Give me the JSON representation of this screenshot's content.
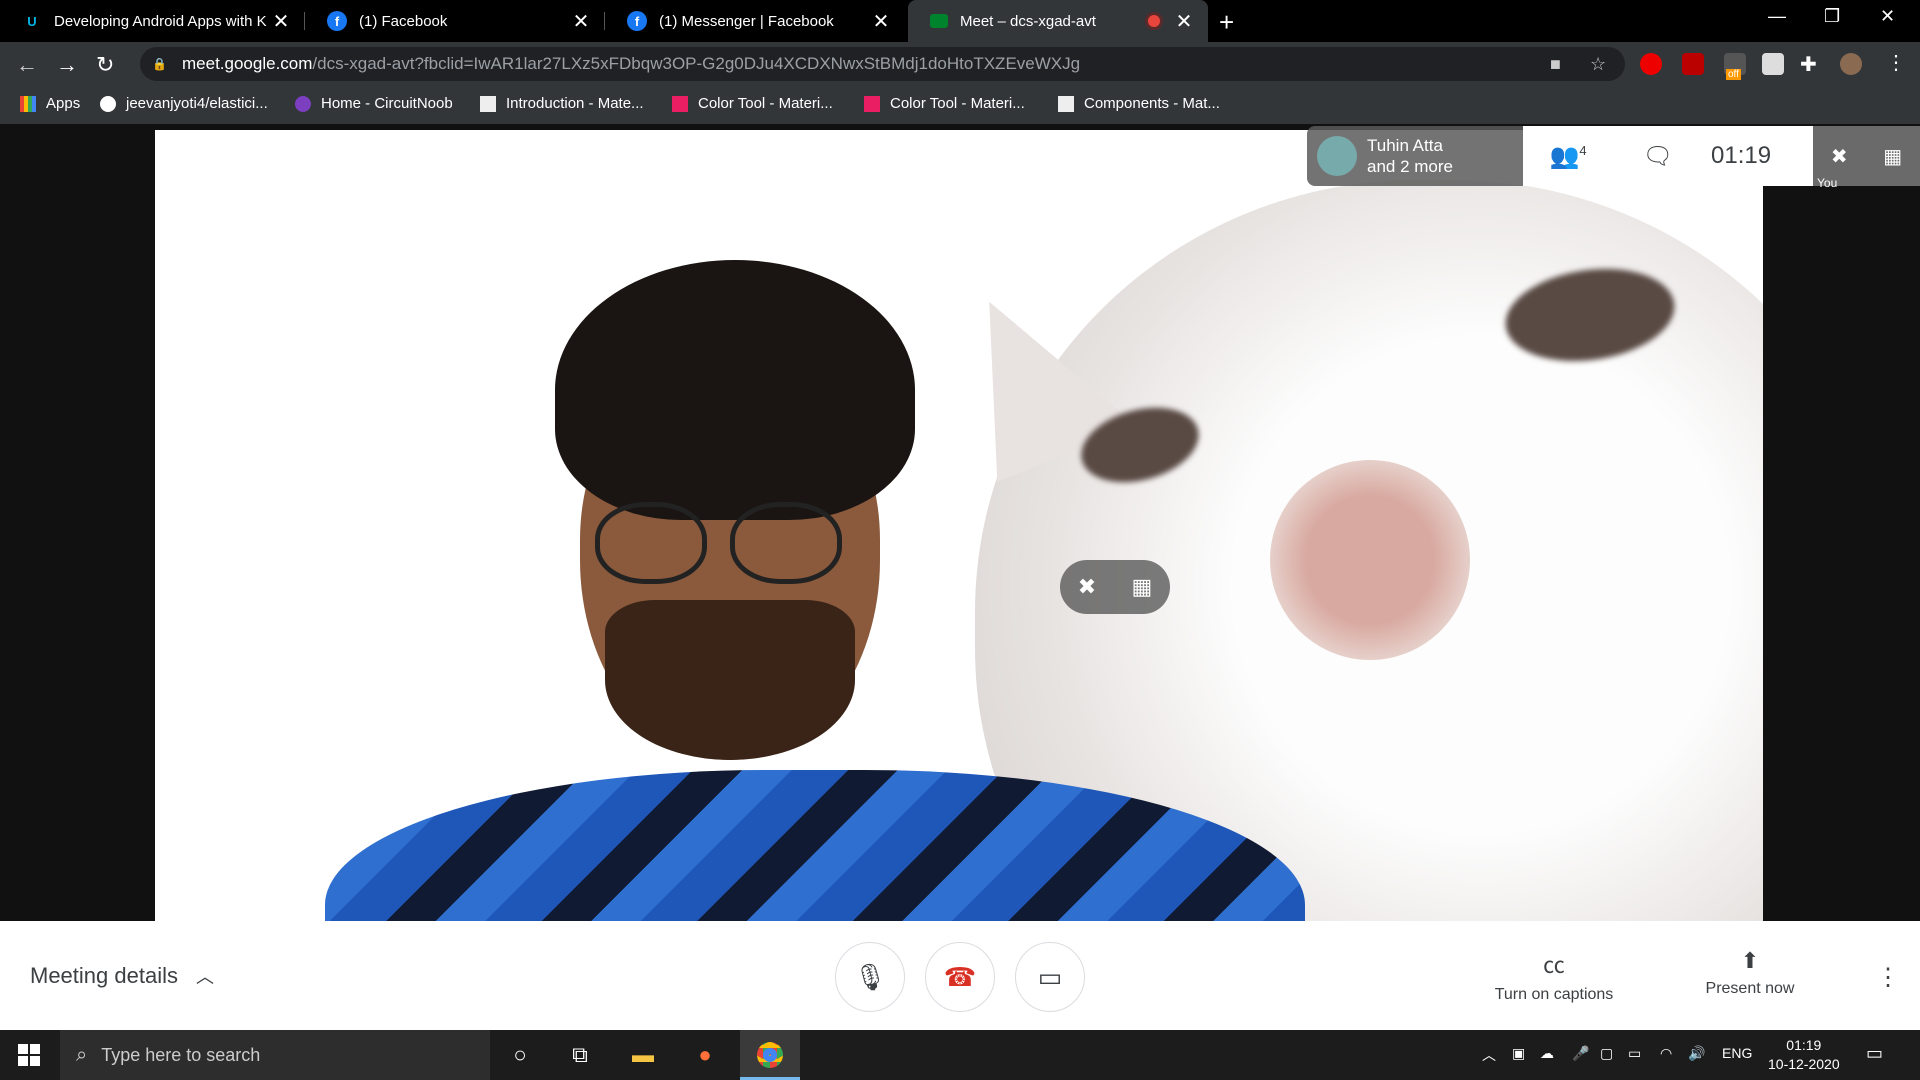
{
  "tabs": [
    {
      "title": "Developing Android Apps with K",
      "favicon": "udacity-icon"
    },
    {
      "title": "(1) Facebook",
      "favicon": "facebook-icon"
    },
    {
      "title": "(1) Messenger | Facebook",
      "favicon": "facebook-icon"
    },
    {
      "title": "Meet – dcs-xgad-avt",
      "favicon": "google-meet-icon",
      "active": true
    }
  ],
  "address_bar": {
    "host": "meet.google.com",
    "path": "/dcs-xgad-avt?fbclid=IwAR1lar27LXz5xFDbqw3OP-G2g0DJu4XCDXNwxStBMdj1doHtoTXZEveWXJg"
  },
  "extension_badge": "off",
  "bookmarks": [
    {
      "label": "Apps",
      "icon": "apps-grid-icon"
    },
    {
      "label": "jeevanjyoti4/elastici...",
      "icon": "github-icon"
    },
    {
      "label": "Home - CircuitNoob",
      "icon": "circuitnoob-icon"
    },
    {
      "label": "Introduction - Mate...",
      "icon": "material-icon"
    },
    {
      "label": "Color Tool - Materi...",
      "icon": "material-color-icon"
    },
    {
      "label": "Color Tool - Materi...",
      "icon": "material-color-icon"
    },
    {
      "label": "Components - Mat...",
      "icon": "material-icon"
    }
  ],
  "meet": {
    "participants_card": {
      "line1": "Tuhin Atta",
      "line2": "and 2 more"
    },
    "participant_count": "4",
    "time": "01:19",
    "self_label": "You",
    "meeting_details_label": "Meeting details",
    "captions_label": "Turn on captions",
    "present_label": "Present now"
  },
  "taskbar": {
    "search_placeholder": "Type here to search",
    "language": "ENG",
    "time": "01:19",
    "date": "10-12-2020"
  },
  "colors": {
    "chrome_dark": "#323639",
    "hangup_red": "#d93025",
    "taskbar": "#1c1c1c"
  }
}
